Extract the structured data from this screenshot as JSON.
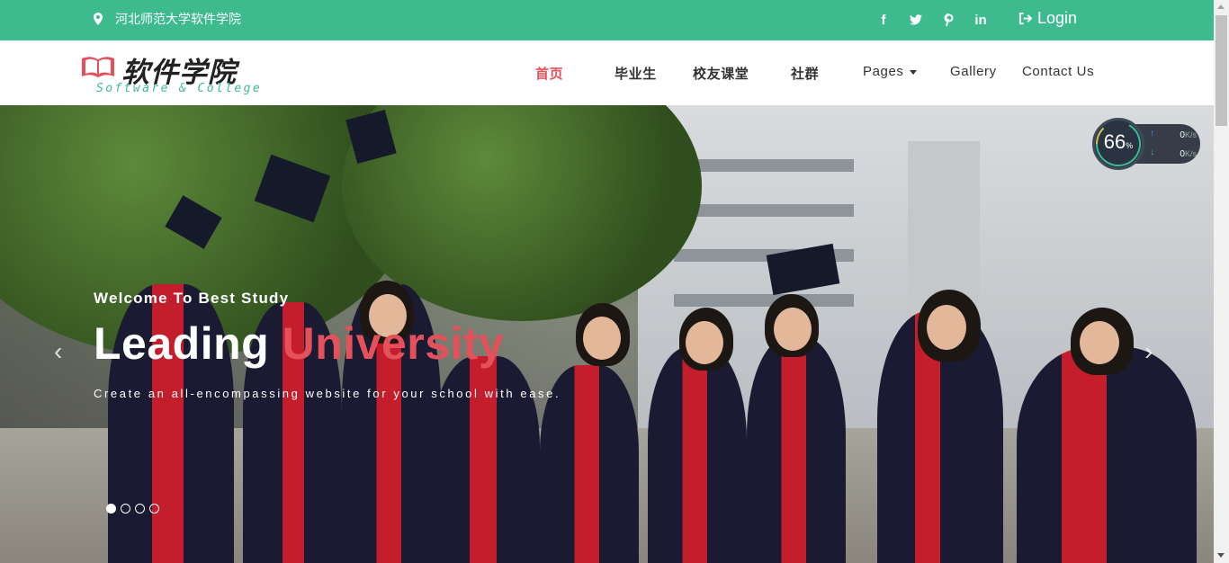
{
  "topbar": {
    "address": "河北师范大学软件学院",
    "social": [
      "f",
      "t",
      "p",
      "in"
    ],
    "login_label": "Login",
    "bg_color": "#3dbb8f"
  },
  "logo": {
    "cn": "软件学院",
    "en": "Software & College"
  },
  "nav": {
    "items": [
      {
        "label": "首页",
        "active": true
      },
      {
        "label": "毕业生",
        "active": false
      },
      {
        "label": "校友课堂",
        "active": false
      },
      {
        "label": "社群",
        "active": false
      },
      {
        "label": "Pages",
        "active": false
      },
      {
        "label": "Gallery",
        "active": false
      },
      {
        "label": "Contact Us",
        "active": false
      }
    ],
    "accent_color": "#e4515b"
  },
  "hero": {
    "welcome": "Welcome To Best Study",
    "headline_main": "Leading",
    "headline_accent": "University",
    "tagline": "Create an all-encompassing website for your school with ease.",
    "slide_count": 4,
    "active_slide": 1
  },
  "speed_widget": {
    "percent": "66",
    "percent_unit": "%",
    "upload": "0",
    "download": "0",
    "rate_unit": "K/s"
  }
}
